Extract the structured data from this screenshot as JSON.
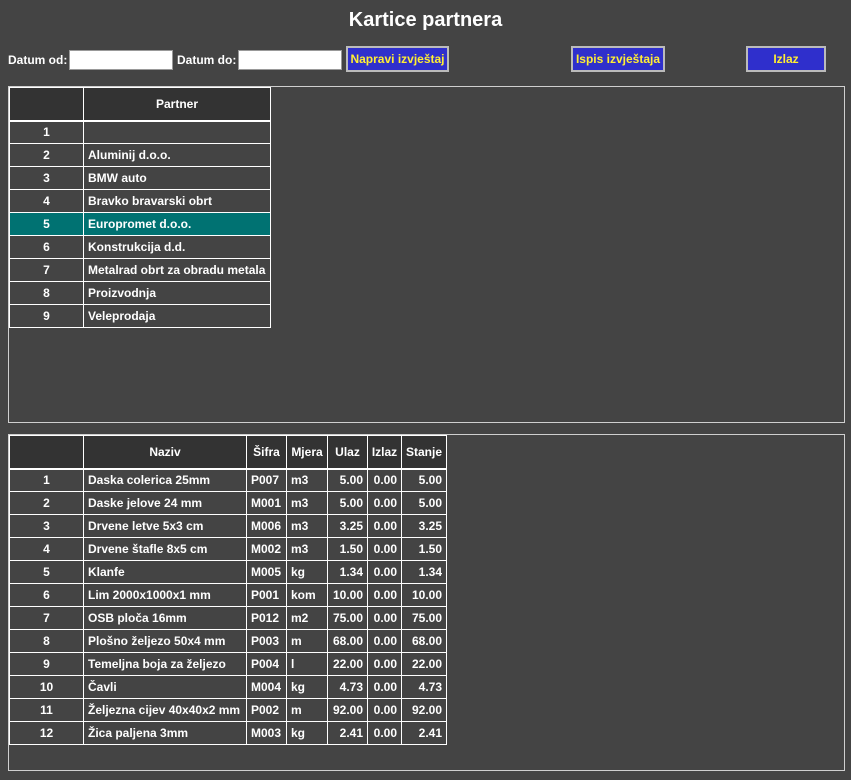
{
  "title": "Kartice partnera",
  "toolbar": {
    "date_from_label": "Datum od:",
    "date_from_value": "",
    "date_to_label": "Datum do:",
    "date_to_value": "",
    "make_report_label": "Napravi izvještaj",
    "print_report_label": "Ispis izvještaja",
    "exit_label": "Izlaz"
  },
  "partners": {
    "header": "Partner",
    "selected_index": 4,
    "rows": [
      {
        "no": "1",
        "name": ""
      },
      {
        "no": "2",
        "name": "Aluminij d.o.o."
      },
      {
        "no": "3",
        "name": "BMW auto"
      },
      {
        "no": "4",
        "name": "Bravko bravarski obrt"
      },
      {
        "no": "5",
        "name": "Europromet d.o.o."
      },
      {
        "no": "6",
        "name": "Konstrukcija d.d."
      },
      {
        "no": "7",
        "name": "Metalrad obrt za obradu metala"
      },
      {
        "no": "8",
        "name": "Proizvodnja"
      },
      {
        "no": "9",
        "name": "Veleprodaja"
      }
    ]
  },
  "items": {
    "headers": {
      "naziv": "Naziv",
      "sifra": "Šifra",
      "mjera": "Mjera",
      "ulaz": "Ulaz",
      "izlaz": "Izlaz",
      "stanje": "Stanje"
    },
    "rows": [
      {
        "no": "1",
        "naziv": "Daska colerica 25mm",
        "sifra": "P007",
        "mjera": "m3",
        "ulaz": "5.00",
        "izlaz": "0.00",
        "stanje": "5.00"
      },
      {
        "no": "2",
        "naziv": "Daske jelove 24 mm",
        "sifra": "M001",
        "mjera": "m3",
        "ulaz": "5.00",
        "izlaz": "0.00",
        "stanje": "5.00"
      },
      {
        "no": "3",
        "naziv": "Drvene letve 5x3 cm",
        "sifra": "M006",
        "mjera": "m3",
        "ulaz": "3.25",
        "izlaz": "0.00",
        "stanje": "3.25"
      },
      {
        "no": "4",
        "naziv": "Drvene štafle 8x5 cm",
        "sifra": "M002",
        "mjera": "m3",
        "ulaz": "1.50",
        "izlaz": "0.00",
        "stanje": "1.50"
      },
      {
        "no": "5",
        "naziv": "Klanfe",
        "sifra": "M005",
        "mjera": "kg",
        "ulaz": "1.34",
        "izlaz": "0.00",
        "stanje": "1.34"
      },
      {
        "no": "6",
        "naziv": "Lim 2000x1000x1 mm",
        "sifra": "P001",
        "mjera": "kom",
        "ulaz": "10.00",
        "izlaz": "0.00",
        "stanje": "10.00"
      },
      {
        "no": "7",
        "naziv": "OSB ploča 16mm",
        "sifra": "P012",
        "mjera": "m2",
        "ulaz": "75.00",
        "izlaz": "0.00",
        "stanje": "75.00"
      },
      {
        "no": "8",
        "naziv": "Plošno željezo 50x4 mm",
        "sifra": "P003",
        "mjera": "m",
        "ulaz": "68.00",
        "izlaz": "0.00",
        "stanje": "68.00"
      },
      {
        "no": "9",
        "naziv": "Temeljna boja za željezo",
        "sifra": "P004",
        "mjera": "l",
        "ulaz": "22.00",
        "izlaz": "0.00",
        "stanje": "22.00"
      },
      {
        "no": "10",
        "naziv": "Čavli",
        "sifra": "M004",
        "mjera": "kg",
        "ulaz": "4.73",
        "izlaz": "0.00",
        "stanje": "4.73"
      },
      {
        "no": "11",
        "naziv": "Željezna cijev 40x40x2 mm",
        "sifra": "P002",
        "mjera": "m",
        "ulaz": "92.00",
        "izlaz": "0.00",
        "stanje": "92.00"
      },
      {
        "no": "12",
        "naziv": "Žica paljena 3mm",
        "sifra": "M003",
        "mjera": "kg",
        "ulaz": "2.41",
        "izlaz": "0.00",
        "stanje": "2.41"
      }
    ]
  }
}
